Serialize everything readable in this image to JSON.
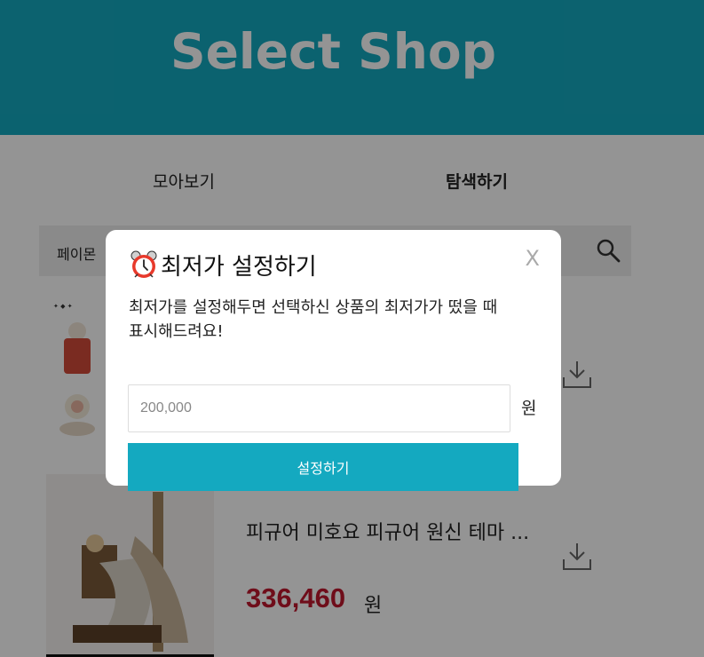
{
  "header": {
    "title": "Select Shop",
    "color": "#14a9c0"
  },
  "tabs": [
    {
      "label": "모아보기",
      "active": false
    },
    {
      "label": "탐색하기",
      "active": true
    }
  ],
  "search": {
    "value": "페이몬",
    "icon": "search-icon"
  },
  "products": [
    {
      "name": "",
      "price": "",
      "unit": ""
    },
    {
      "name": "피규어 미호요 피규어 원신 테마 ...",
      "price": "336,460",
      "unit": "원"
    }
  ],
  "modal": {
    "icon": "alarm-clock-icon",
    "title": "최저가 설정하기",
    "close_label": "X",
    "description_line1": "최저가를 설정해두면 선택하신 상품의 최저가가 떴을 때",
    "description_line2": "표시해드려요!",
    "input_placeholder": "200,000",
    "currency_label": "원",
    "submit_label": "설정하기"
  },
  "colors": {
    "accent": "#14a9c0",
    "price": "#c0182e",
    "overlay": "rgba(0,0,0,0.42)"
  }
}
